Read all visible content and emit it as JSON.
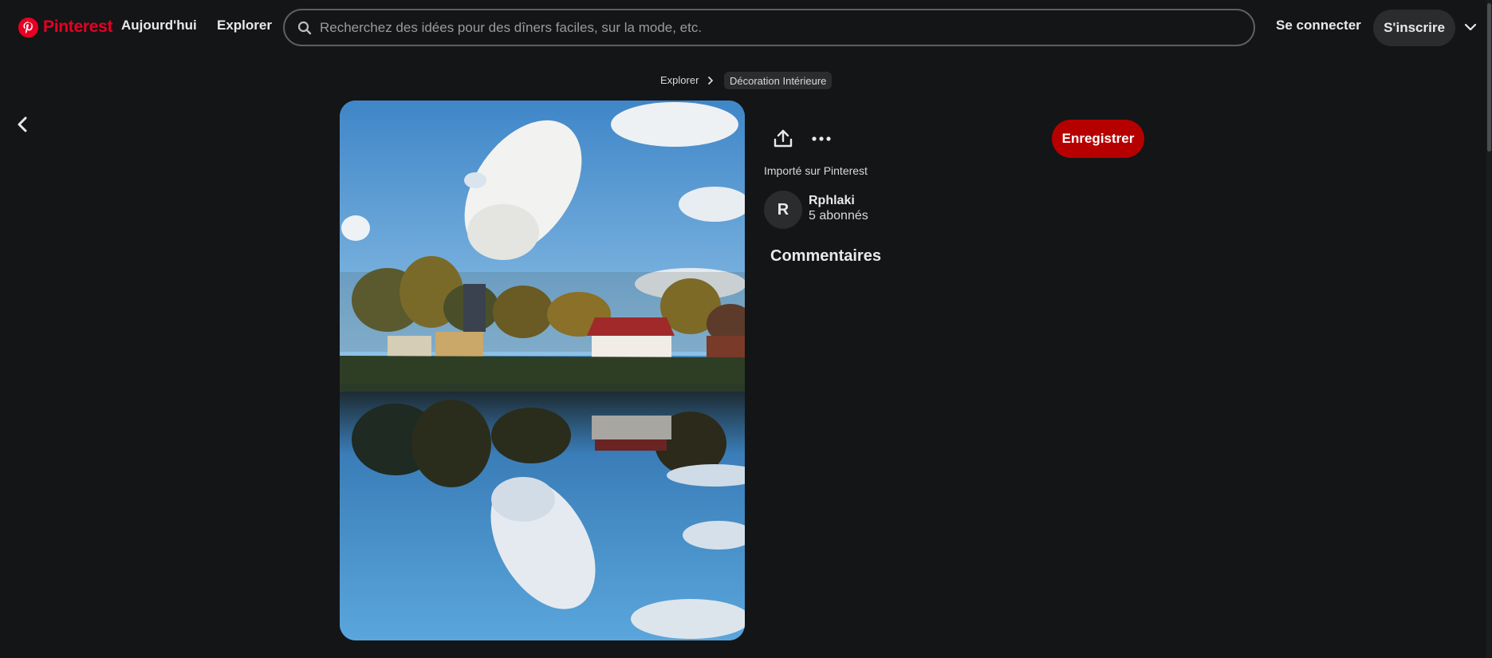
{
  "header": {
    "logo_text": "Pinterest",
    "nav_today": "Aujourd'hui",
    "nav_explore": "Explorer",
    "search_placeholder": "Recherchez des idées pour des dîners faciles, sur la mode, etc.",
    "login_label": "Se connecter",
    "signup_label": "S'inscrire"
  },
  "breadcrumb": {
    "items": [
      "Explorer",
      "Décoration Intérieure"
    ]
  },
  "pin": {
    "save_label": "Enregistrer",
    "imported_label": "Importé sur Pinterest",
    "author": {
      "initial": "R",
      "name": "Rphlaki",
      "followers": "5 abonnés"
    },
    "comments_title": "Commentaires"
  },
  "colors": {
    "brand": "#e60023",
    "save_button": "#b60000",
    "background": "#141517"
  },
  "icons": [
    "pinterest-logo-icon",
    "search-icon",
    "chevron-down-icon",
    "chevron-right-icon",
    "back-arrow-icon",
    "share-icon",
    "more-icon"
  ]
}
